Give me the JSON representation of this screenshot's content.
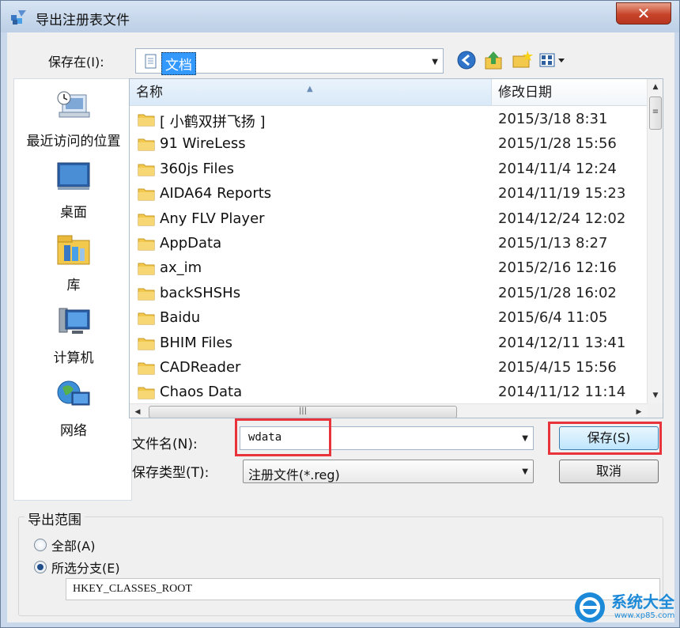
{
  "window": {
    "title": "导出注册表文件",
    "close_glyph": "✕"
  },
  "save_in": {
    "label": "保存在(I):",
    "value": "文档"
  },
  "toolbar": {
    "icons": [
      "back-icon",
      "up-folder-icon",
      "new-folder-icon",
      "view-menu-icon"
    ]
  },
  "places": [
    {
      "label": "最近访问的位置",
      "icon": "recent-places-icon"
    },
    {
      "label": "桌面",
      "icon": "desktop-icon"
    },
    {
      "label": "库",
      "icon": "libraries-icon"
    },
    {
      "label": "计算机",
      "icon": "computer-icon"
    },
    {
      "label": "网络",
      "icon": "network-icon"
    }
  ],
  "file_list": {
    "columns": [
      "名称",
      "修改日期"
    ],
    "rows": [
      {
        "name": "[ 小鹤双拼飞扬 ]",
        "date": "2015/3/18 8:31"
      },
      {
        "name": "91 WireLess",
        "date": "2015/1/28 15:56"
      },
      {
        "name": "360js Files",
        "date": "2014/11/4 12:24"
      },
      {
        "name": "AIDA64 Reports",
        "date": "2014/11/19 15:23"
      },
      {
        "name": "Any FLV Player",
        "date": "2014/12/24 12:02"
      },
      {
        "name": "AppData",
        "date": "2015/1/13 8:27"
      },
      {
        "name": "ax_im",
        "date": "2015/2/16 12:16"
      },
      {
        "name": "backSHSHs",
        "date": "2015/1/28 16:02"
      },
      {
        "name": "Baidu",
        "date": "2015/6/4 11:05"
      },
      {
        "name": "BHIM Files",
        "date": "2014/12/11 13:41"
      },
      {
        "name": "CADReader",
        "date": "2015/4/15 15:56"
      },
      {
        "name": "Chaos Data",
        "date": "2014/11/12 11:14"
      }
    ]
  },
  "filename": {
    "label": "文件名(N):",
    "value": "wdata"
  },
  "file_type": {
    "label": "保存类型(T):",
    "value": "注册文件(*.reg)"
  },
  "buttons": {
    "save": "保存(S)",
    "cancel": "取消"
  },
  "export_range": {
    "title": "导出范围",
    "all_label": "全部(A)",
    "branch_label": "所选分支(E)",
    "selected": "branch",
    "branch_value": "HKEY_CLASSES_ROOT"
  },
  "watermark": {
    "title": "系统大全",
    "url": "www.xp85.com"
  },
  "colors": {
    "highlight_box": "#e8333b",
    "selection": "#3399ff",
    "title_bar": "#bccfe6"
  }
}
